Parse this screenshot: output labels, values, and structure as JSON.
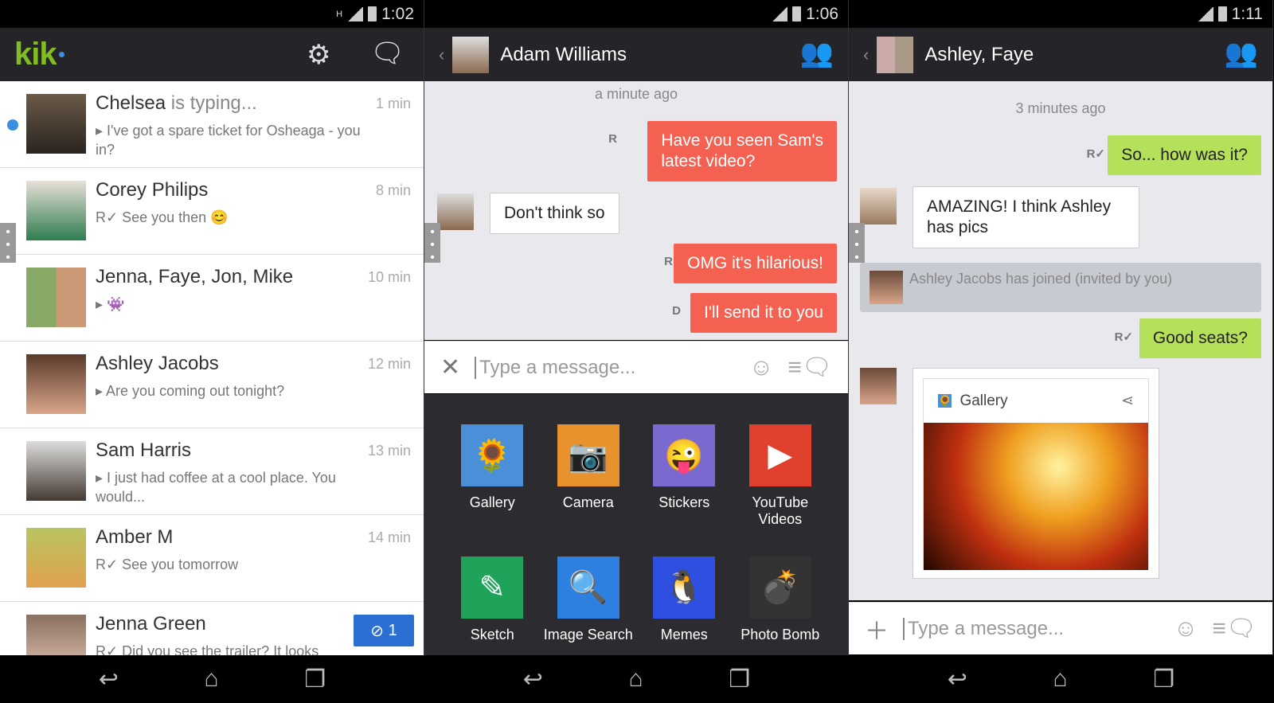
{
  "screens": [
    {
      "time": "1:02",
      "network": "H",
      "app_name": "kik",
      "conversations": [
        {
          "name": "Chelsea",
          "typing": "is typing...",
          "time": "1 min",
          "preview": "I've got a spare ticket for Osheaga - you in?",
          "unread": true
        },
        {
          "name": "Corey Philips",
          "time": "8 min",
          "preview": "See you then 😊"
        },
        {
          "name": "Jenna, Faye, Jon, Mike",
          "time": "10 min",
          "preview": "👾"
        },
        {
          "name": "Ashley Jacobs",
          "time": "12 min",
          "preview": "Are you coming out tonight?"
        },
        {
          "name": "Sam Harris",
          "time": "13 min",
          "preview": "I just had coffee at a cool place. You would..."
        },
        {
          "name": "Amber M",
          "time": "14 min",
          "preview": "See you tomorrow"
        },
        {
          "name": "Jenna Green",
          "time": "",
          "preview": "Did you see the trailer? It looks",
          "badge": "1"
        }
      ]
    },
    {
      "time": "1:06",
      "title": "Adam Williams",
      "timestamp": "a minute ago",
      "messages": [
        "Have you seen Sam's",
        "latest video?",
        "Don't think so",
        "OMG it's hilarious!",
        "I'll send it to you"
      ],
      "receipts": [
        "R",
        "R",
        "D"
      ],
      "input_placeholder": "Type a message...",
      "apps": [
        "Gallery",
        "Camera",
        "Stickers",
        "YouTube Videos",
        "Sketch",
        "Image Search",
        "Memes",
        "Photo Bomb"
      ]
    },
    {
      "time": "1:11",
      "title": "Ashley, Faye",
      "timestamp": "3 minutes ago",
      "messages": [
        "So... how was it?",
        "AMAZING! I think Ashley has pics",
        "Ashley Jacobs has joined (invited by you)",
        "Good seats?"
      ],
      "card_title": "Gallery",
      "input_placeholder": "Type a message..."
    }
  ],
  "colors": {
    "kik_green": "#82bc23",
    "outgoing_red": "#f56150",
    "outgoing_green": "#b5e05a",
    "header": "#252429",
    "badge_blue": "#2a6fd1"
  }
}
